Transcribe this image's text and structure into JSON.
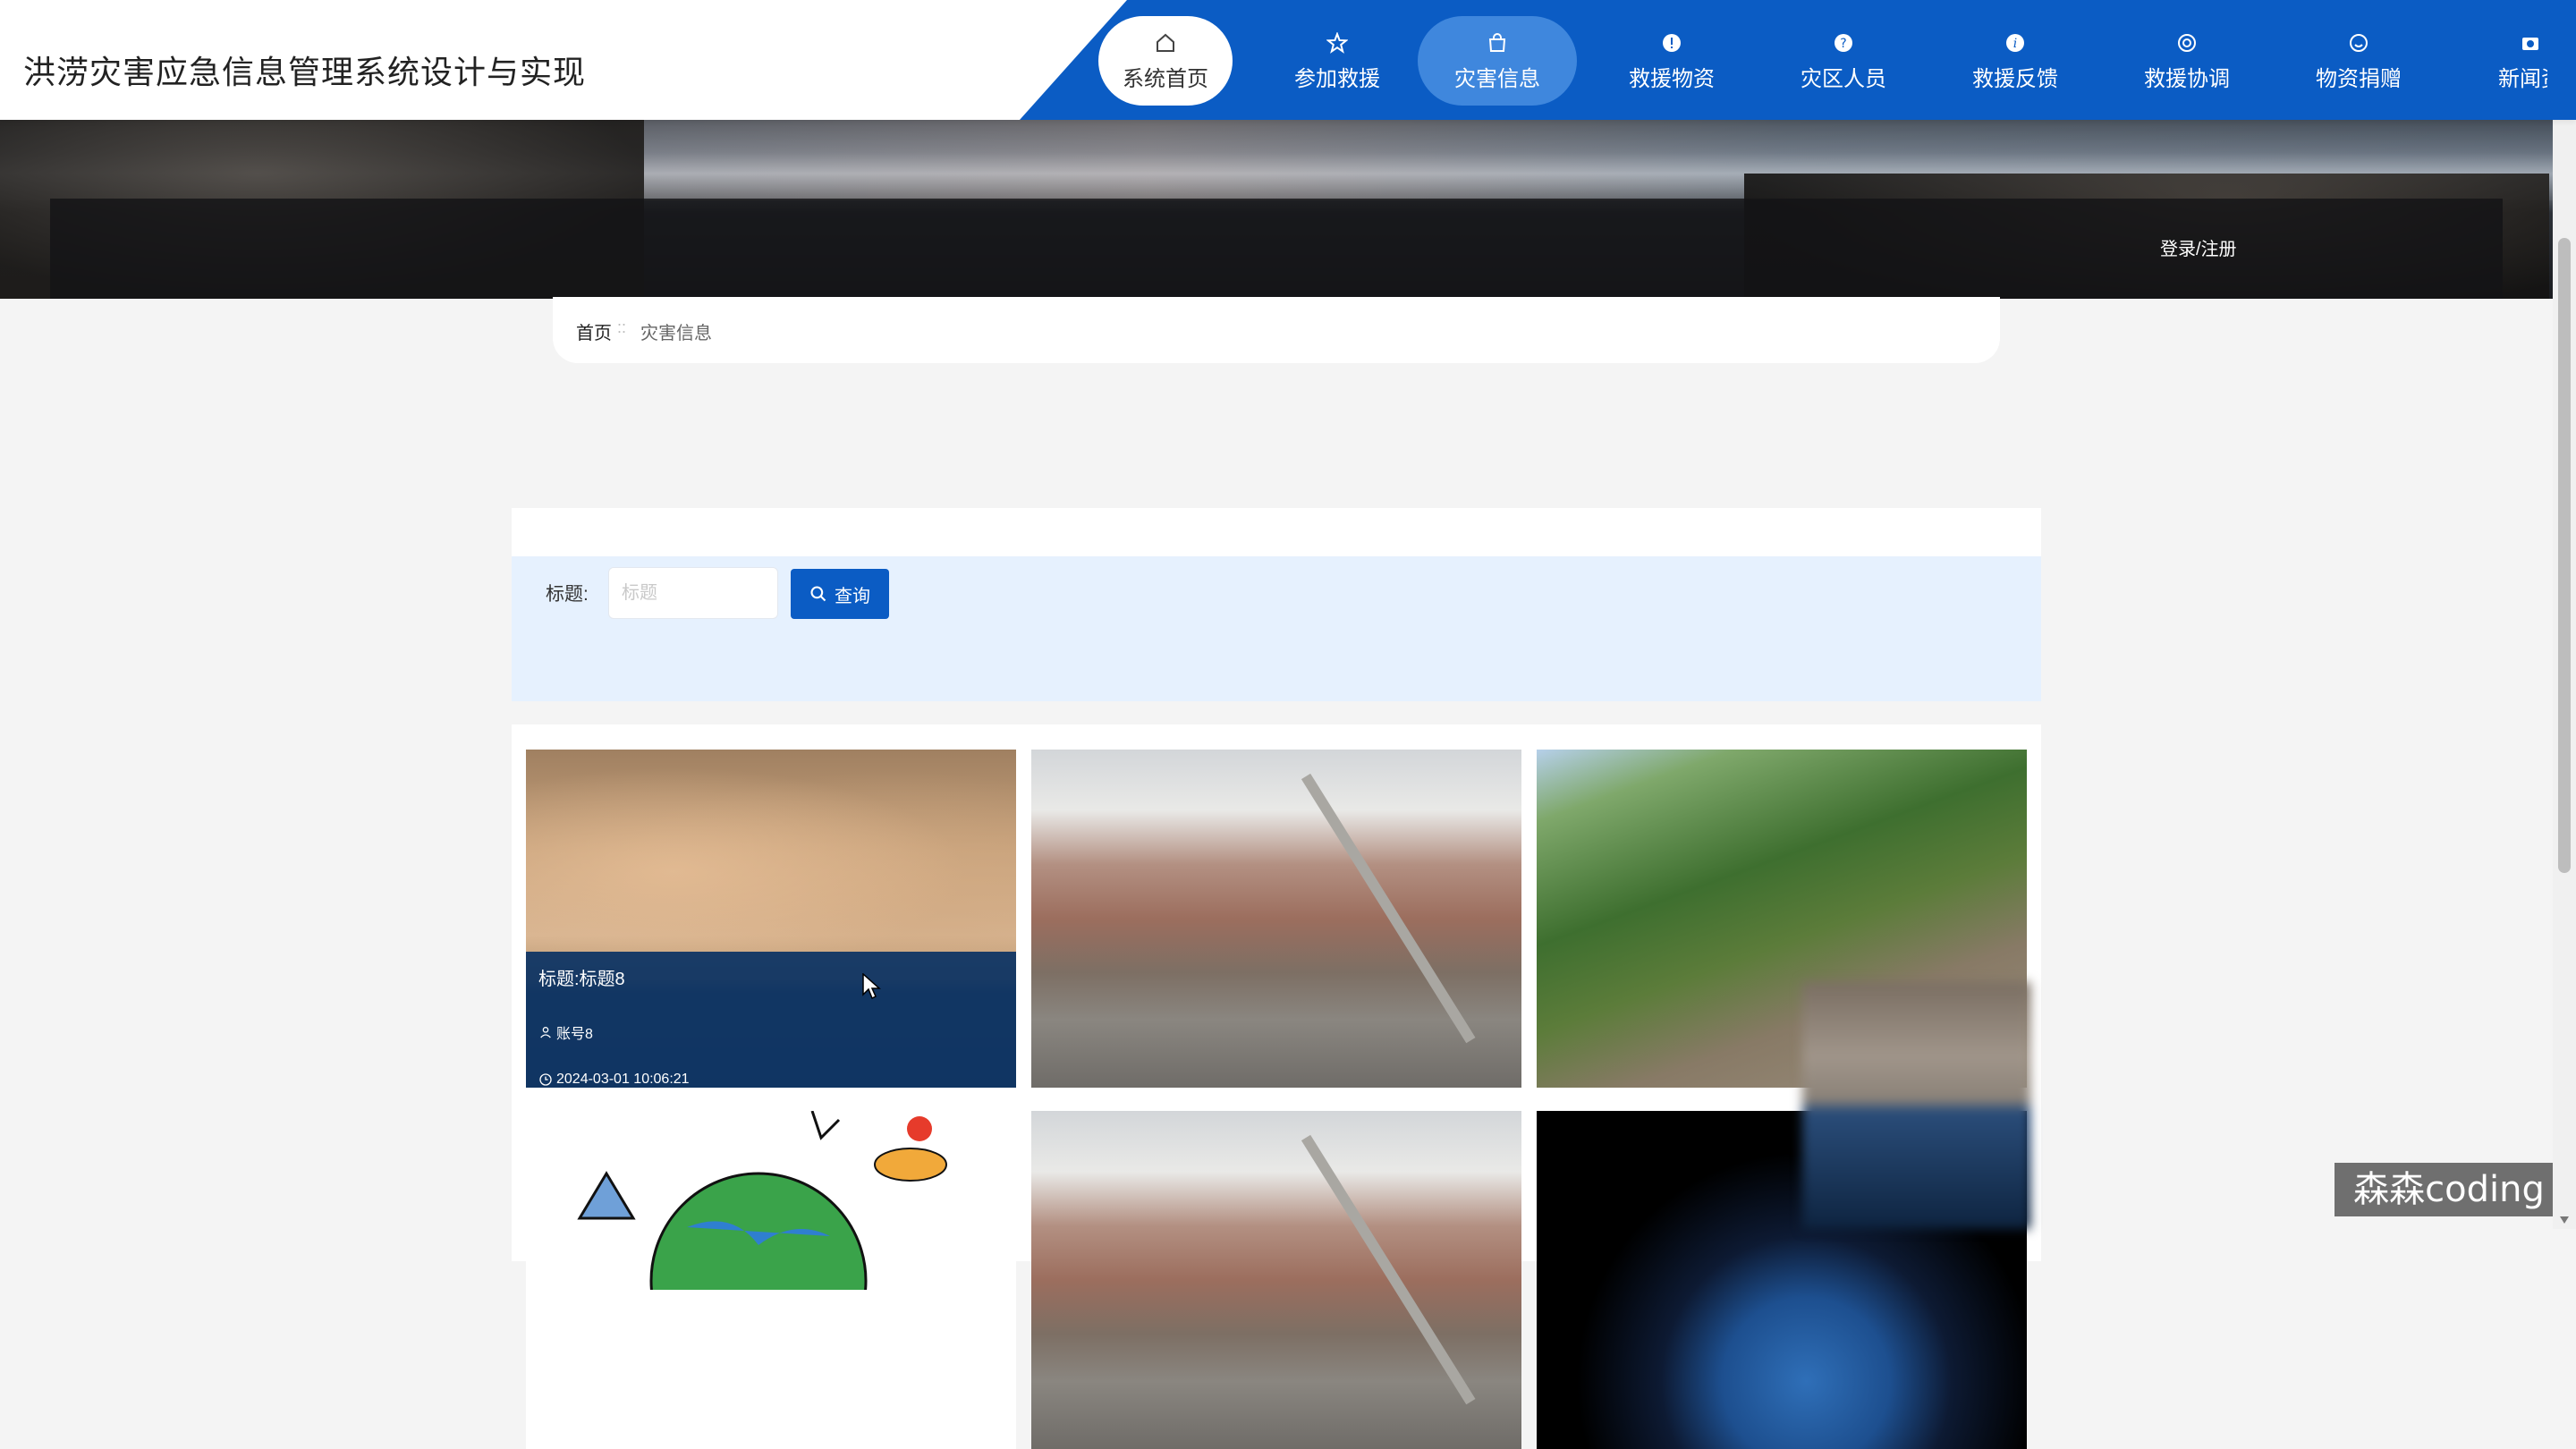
{
  "header": {
    "site_title": "洪涝灾害应急信息管理系统设计与实现"
  },
  "nav": [
    {
      "label": "系统首页",
      "icon": "home-icon"
    },
    {
      "label": "参加救援",
      "icon": "star-icon"
    },
    {
      "label": "灾害信息",
      "icon": "bag-icon"
    },
    {
      "label": "救援物资",
      "icon": "alert-icon"
    },
    {
      "label": "灾区人员",
      "icon": "question-icon"
    },
    {
      "label": "救援反馈",
      "icon": "info-icon"
    },
    {
      "label": "救援协调",
      "icon": "lifebuoy-icon"
    },
    {
      "label": "物资捐赠",
      "icon": "smile-icon"
    },
    {
      "label": "新闻资",
      "icon": "camera-icon"
    }
  ],
  "banner": {
    "login_label": "登录/注册"
  },
  "breadcrumb": {
    "home": "首页",
    "separator": "::",
    "current": "灾害信息"
  },
  "search": {
    "label": "标题:",
    "placeholder": "标题",
    "button": "查询"
  },
  "cards": [
    {
      "title": "标题:标题8",
      "account": "账号8",
      "date": "2024-03-01 10:06:21"
    }
  ],
  "watermark": "森森coding",
  "colors": {
    "primary": "#0b5cc4",
    "active_nav": "#3f87dd",
    "search_bg": "#e6f1fe"
  }
}
